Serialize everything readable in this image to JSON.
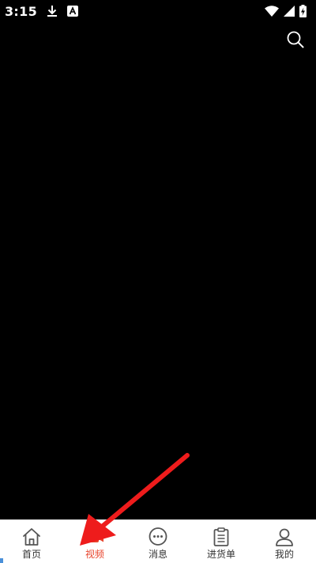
{
  "status_bar": {
    "time": "3:15",
    "icons": [
      "download-icon",
      "a-letter-icon",
      "wifi-icon",
      "signal-icon",
      "battery-charging-icon"
    ]
  },
  "header": {
    "search_icon": "search-icon"
  },
  "bottom_nav": {
    "items": [
      {
        "label": "首页",
        "icon": "home-icon",
        "active": false
      },
      {
        "label": "视频",
        "icon": "video-icon",
        "active": true
      },
      {
        "label": "消息",
        "icon": "chat-bubble-icon",
        "active": false
      },
      {
        "label": "进货单",
        "icon": "clipboard-icon",
        "active": false
      },
      {
        "label": "我的",
        "icon": "user-icon",
        "active": false
      }
    ]
  },
  "colors": {
    "background": "#000000",
    "nav_background": "#ffffff",
    "active": "#e8442c",
    "inactive": "#333333",
    "annotation": "#ee1c1c"
  }
}
